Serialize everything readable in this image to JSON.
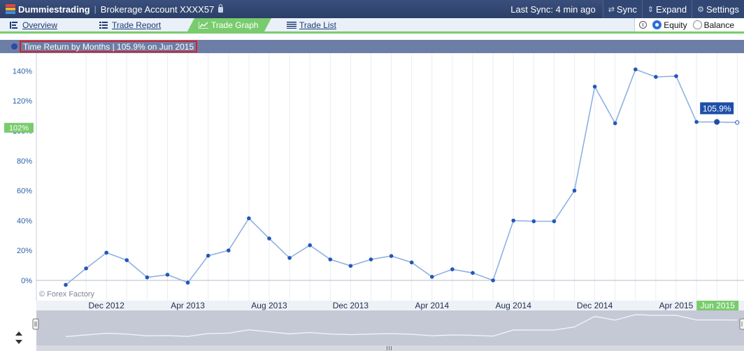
{
  "header": {
    "brand": "Dummiestrading",
    "account": "Brokerage Account XXXX57",
    "sync_status": "Last Sync: 4 min ago",
    "sync_label": "Sync",
    "expand_label": "Expand",
    "settings_label": "Settings"
  },
  "tabs": [
    {
      "label": "Overview",
      "icon": "list-icon",
      "active": false
    },
    {
      "label": "Trade Report",
      "icon": "table-icon",
      "active": false
    },
    {
      "label": "Trade Graph",
      "icon": "line-chart-icon",
      "active": true
    },
    {
      "label": "Trade List",
      "icon": "lines-icon",
      "active": false
    }
  ],
  "mode": {
    "options": [
      "Equity",
      "Balance"
    ],
    "selected": "Equity"
  },
  "colors": {
    "accent": "#79cc6e",
    "header_bg": "#2b3f68",
    "line": "#8fb1e0",
    "marker": "#2257b8",
    "highlight_red": "#d71f26"
  },
  "chart_data": {
    "type": "line",
    "title": "Time Return by Months | 105.9% on Jun 2015",
    "ytick_labels": [
      "0%",
      "20%",
      "40%",
      "60%",
      "80%",
      "100%",
      "120%",
      "140%"
    ],
    "ylim": [
      -15,
      150
    ],
    "xtick_labels": [
      "Dec 2012",
      "Apr 2013",
      "Aug 2013",
      "Dec 2013",
      "Apr 2014",
      "Aug 2014",
      "Dec 2014",
      "Apr 2015",
      "Jun 2015"
    ],
    "highlighted_tick": "Jun 2015",
    "current_value_label": "102%",
    "tooltip": "105.9%",
    "watermark": "© Forex Factory",
    "x": [
      "Oct 2012",
      "Nov 2012",
      "Dec 2012",
      "Jan 2013",
      "Feb 2013",
      "Mar 2013",
      "Apr 2013",
      "May 2013",
      "Jun 2013",
      "Jul 2013",
      "Aug 2013",
      "Sep 2013",
      "Oct 2013",
      "Nov 2013",
      "Dec 2013",
      "Jan 2014",
      "Feb 2014",
      "Mar 2014",
      "Apr 2014",
      "May 2014",
      "Jun 2014",
      "Jul 2014",
      "Aug 2014",
      "Sep 2014",
      "Oct 2014",
      "Nov 2014",
      "Dec 2014",
      "Jan 2015",
      "Feb 2015",
      "Mar 2015",
      "Apr 2015",
      "May 2015",
      "Jun 2015",
      "Jul 2015"
    ],
    "values": [
      -3,
      8,
      18.5,
      13.5,
      2,
      3.8,
      -1.5,
      16.5,
      20,
      41.5,
      28,
      15,
      23.5,
      14,
      9.7,
      14,
      16.3,
      12,
      2.4,
      7.4,
      5,
      0,
      40,
      39.5,
      39.5,
      60,
      129.5,
      105,
      141,
      136,
      136.5,
      105.9,
      105.9,
      105.5
    ],
    "grid": true
  }
}
